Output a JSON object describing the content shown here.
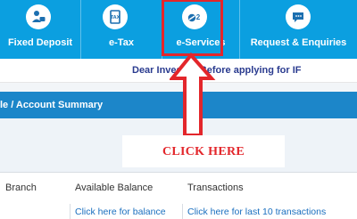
{
  "nav": {
    "items": [
      {
        "label": "Fixed Deposit",
        "icon": "person-money-icon"
      },
      {
        "label": "e-Tax",
        "icon": "tax-document-icon"
      },
      {
        "label": "e-Services",
        "icon": "services-pills-icon"
      },
      {
        "label": "Request & Enquiries",
        "icon": "chat-bubble-icon"
      }
    ]
  },
  "info": {
    "marquee": "Dear Investor, Before applying for IF"
  },
  "breadcrumb": {
    "text": "le  /  Account Summary"
  },
  "annotation": {
    "click_here": "CLICK HERE",
    "highlight_color": "#e3262b"
  },
  "table": {
    "headers": [
      "Branch",
      "Available Balance",
      "Transactions"
    ],
    "row": {
      "balance_link": "Click here for balance",
      "transactions_link": "Click here for last 10 transactions"
    }
  },
  "colors": {
    "nav_bg": "#0b9fe0",
    "breadcrumb_bg": "#1c86c9",
    "link": "#1a6fbf"
  }
}
